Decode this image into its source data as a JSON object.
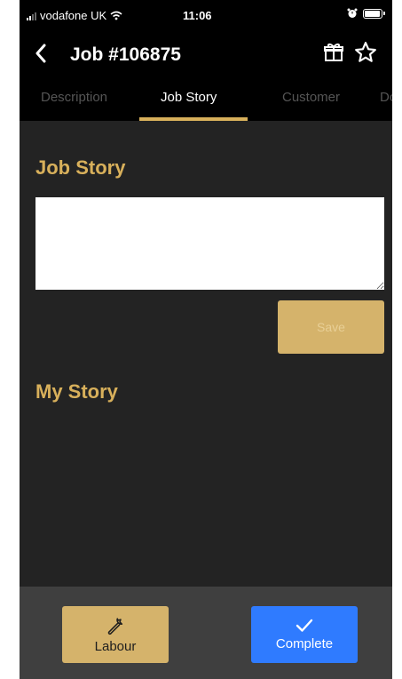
{
  "status_bar": {
    "carrier": "vodafone UK",
    "time": "11:06"
  },
  "header": {
    "title": "Job #106875",
    "back_icon": "chevron-left-icon",
    "gift_icon": "gift-icon",
    "star_icon": "star-icon"
  },
  "tabs": [
    {
      "label": "Description",
      "active": false
    },
    {
      "label": "Job Story",
      "active": true
    },
    {
      "label": "Customer",
      "active": false
    },
    {
      "label": "Doc",
      "active": false
    }
  ],
  "job_story": {
    "heading": "Job Story",
    "value": "",
    "save_label": "Save"
  },
  "my_story": {
    "heading": "My Story"
  },
  "actions": {
    "labour": {
      "label": "Labour",
      "icon": "wrench-icon"
    },
    "complete": {
      "label": "Complete",
      "icon": "checkmark-icon"
    }
  },
  "colors": {
    "accent": "#d8b05b",
    "primary": "#2f7bff",
    "background": "#232323",
    "bar": "#000000"
  }
}
